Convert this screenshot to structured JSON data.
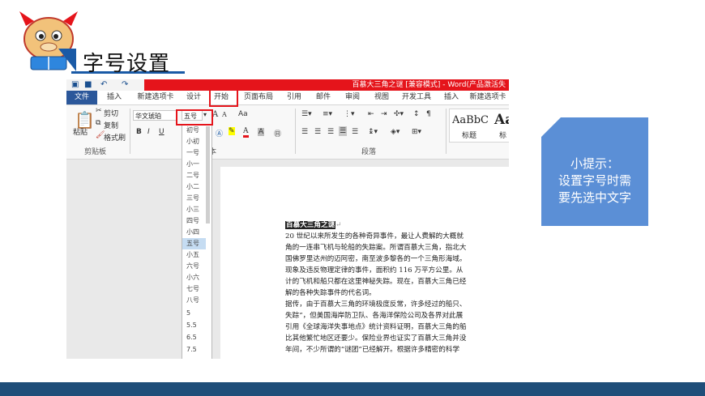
{
  "slide": {
    "title": "字号设置",
    "tip": [
      "小提示：",
      "设置字号时需",
      "要先选中文字"
    ]
  },
  "colors": {
    "accent": "#1a5aa6",
    "highlight_red": "#e5141b",
    "tip_bg": "#5b8fd6",
    "footer": "#1f4e79",
    "word_blue": "#2b579a"
  },
  "word": {
    "window_title": "百慕大三角之谜 [兼容模式] - Word(产品激活失",
    "quick_access": [
      "save-icon",
      "undo-icon",
      "redo-icon"
    ],
    "tabs": [
      "文件",
      "插入",
      "新建选项卡",
      "设计",
      "开始",
      "页面布局",
      "引用",
      "邮件",
      "审阅",
      "视图",
      "开发工具",
      "插入",
      "新建选项卡"
    ],
    "clipboard": {
      "paste": "粘贴",
      "cut": "剪切",
      "copy": "复制",
      "format_painter": "格式刷",
      "group": "剪贴板"
    },
    "font": {
      "name": "华文琥珀",
      "size": "五号",
      "group_fragment": "本",
      "bold": "B",
      "italic": "I",
      "underline": "U",
      "grow": "A",
      "shrink": "A",
      "case": "Aa",
      "color_a": "A"
    },
    "paragraph": {
      "group": "段落"
    },
    "styles": [
      {
        "preview": "AaBbC",
        "name": "标题"
      },
      {
        "preview": "Aa",
        "name": "标"
      }
    ],
    "font_sizes": [
      "初号",
      "小初",
      "一号",
      "小一",
      "二号",
      "小二",
      "三号",
      "小三",
      "四号",
      "小四",
      "五号",
      "小五",
      "六号",
      "小六",
      "七号",
      "八号",
      "5",
      "5.5",
      "6.5",
      "7.5"
    ],
    "selected_size": "五号",
    "document": {
      "heading": "百慕大三角之谜",
      "lines": [
        "20 世纪以来所发生的各种奇异事件，最让人费解的大概就",
        "角的一连串飞机与轮船的失踪案。所谓百慕大三角，指北大",
        "国佛罗里达州的迈阿密，南至波多黎各的一个三角形海域。",
        "现象及违反物理定律的事件，面积约 116 万平方公里。从",
        "计的飞机和船只都在这里神秘失踪。现在，百慕大三角已经",
        "解的各种失踪事件的代名词。",
        "据传，由于百慕大三角的环境极度反常，许多经过的船只、",
        "失踪”，但美国海岸防卫队、各海洋保险公司及各界对此展",
        "引用《全球海洋失事地点》统计资料证明，百慕大三角的船",
        "比其他繁忙地区还要少。保险业界也证实了百慕大三角并没",
        "年间，不少所谓的“谜团”已经解开。根据许多精密的科学"
      ]
    }
  }
}
